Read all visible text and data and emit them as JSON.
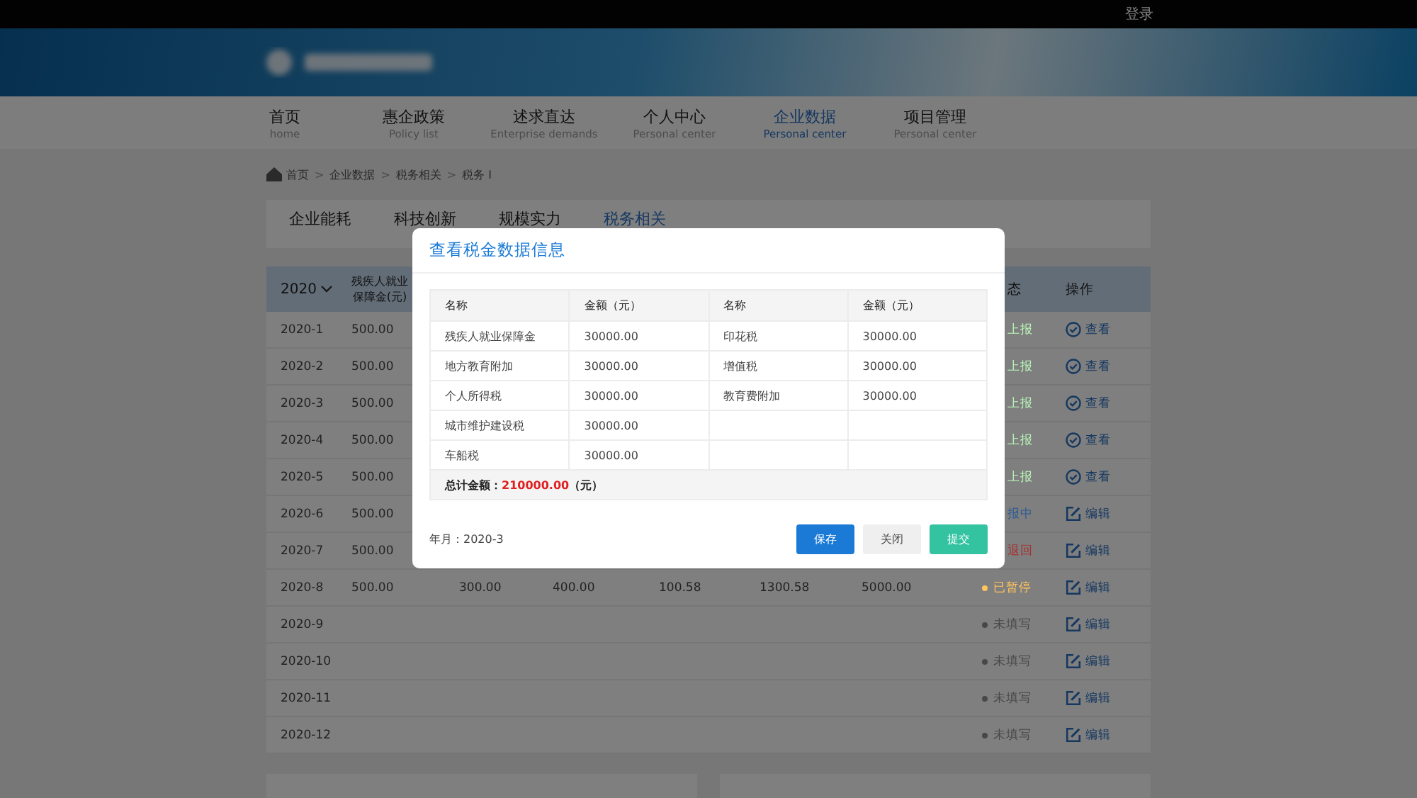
{
  "top_bar": {
    "login": "登录"
  },
  "nav": [
    {
      "label": "首页",
      "sub": "home",
      "selected": false
    },
    {
      "label": "惠企政策",
      "sub": "Policy list",
      "selected": false
    },
    {
      "label": "述求直达",
      "sub": "Enterprise demands",
      "selected": false
    },
    {
      "label": "个人中心",
      "sub": "Personal center",
      "selected": false
    },
    {
      "label": "企业数据",
      "sub": "Personal center",
      "selected": true
    },
    {
      "label": "项目管理",
      "sub": "Personal center",
      "selected": false
    }
  ],
  "breadcrumb": [
    {
      "kind": "link",
      "text": "首页"
    },
    {
      "kind": "separator",
      "text": ">"
    },
    {
      "kind": "link",
      "text": "企业数据"
    },
    {
      "kind": "separator",
      "text": ">"
    },
    {
      "kind": "link",
      "text": "税务相关"
    },
    {
      "kind": "separator",
      "text": ">"
    },
    {
      "kind": "link",
      "text": "税务 I"
    }
  ],
  "tabs": [
    {
      "label": "企业能耗",
      "selected": false
    },
    {
      "label": "科技创新",
      "selected": false
    },
    {
      "label": "规模实力",
      "selected": false
    },
    {
      "label": "税务相关",
      "selected": true
    }
  ],
  "table": {
    "year": "2020",
    "columns": [
      "残疾人就业保障金(元)"
    ],
    "status_header": "态",
    "action_header": "操作",
    "rows": [
      {
        "month": "2020-1",
        "cells": [
          "500.00"
        ],
        "status": {
          "text": "上报",
          "color": "#b8f5b8",
          "dot": false
        },
        "action": {
          "kind": "view",
          "label": "查看"
        }
      },
      {
        "month": "2020-2",
        "cells": [
          "500.00"
        ],
        "status": {
          "text": "上报",
          "color": "#b8f5b8",
          "dot": false
        },
        "action": {
          "kind": "view",
          "label": "查看"
        }
      },
      {
        "month": "2020-3",
        "cells": [
          "500.00"
        ],
        "status": {
          "text": "上报",
          "color": "#b8f5b8",
          "dot": false
        },
        "action": {
          "kind": "view",
          "label": "查看"
        }
      },
      {
        "month": "2020-4",
        "cells": [
          "500.00"
        ],
        "status": {
          "text": "上报",
          "color": "#b8f5b8",
          "dot": false
        },
        "action": {
          "kind": "view",
          "label": "查看"
        }
      },
      {
        "month": "2020-5",
        "cells": [
          "500.00"
        ],
        "status": {
          "text": "上报",
          "color": "#b8f5b8",
          "dot": false
        },
        "action": {
          "kind": "view",
          "label": "查看"
        }
      },
      {
        "month": "2020-6",
        "cells": [
          "500.00"
        ],
        "status": {
          "text": "报中",
          "color": "#2a5a95",
          "dot": false
        },
        "action": {
          "kind": "edit",
          "label": "编辑"
        }
      },
      {
        "month": "2020-7",
        "cells": [
          "500.00"
        ],
        "status": {
          "text": "退回",
          "color": "#a83030",
          "dot": false
        },
        "action": {
          "kind": "edit",
          "label": "编辑"
        }
      },
      {
        "month": "2020-8",
        "cells": [
          "500.00",
          "300.00",
          "400.00",
          "100.58",
          "1300.58",
          "5000.00"
        ],
        "status": {
          "text": "已暂停",
          "color": "#ffc45e",
          "dot": true
        },
        "action": {
          "kind": "edit",
          "label": "编辑"
        }
      },
      {
        "month": "2020-9",
        "cells": [],
        "status": {
          "text": "未填写",
          "color": "#484848",
          "dot": true
        },
        "action": {
          "kind": "edit",
          "label": "编辑"
        }
      },
      {
        "month": "2020-10",
        "cells": [],
        "status": {
          "text": "未填写",
          "color": "#484848",
          "dot": true
        },
        "action": {
          "kind": "edit",
          "label": "编辑"
        }
      },
      {
        "month": "2020-11",
        "cells": [],
        "status": {
          "text": "未填写",
          "color": "#484848",
          "dot": true
        },
        "action": {
          "kind": "edit",
          "label": "编辑"
        }
      },
      {
        "month": "2020-12",
        "cells": [],
        "status": {
          "text": "未填写",
          "color": "#484848",
          "dot": true
        },
        "action": {
          "kind": "edit",
          "label": "编辑"
        }
      }
    ]
  },
  "dialog": {
    "title": "查看税金数据信息",
    "columns": [
      "名称",
      "金额（元）",
      "名称",
      "金额（元）"
    ],
    "rows": [
      [
        "残疾人就业保障金",
        "30000.00",
        "印花税",
        "30000.00"
      ],
      [
        "地方教育附加",
        "30000.00",
        "增值税",
        "30000.00"
      ],
      [
        "个人所得税",
        "30000.00",
        "教育费附加",
        "30000.00"
      ],
      [
        "城市维护建设税",
        "30000.00"
      ],
      [
        "车船税",
        "30000.00"
      ]
    ],
    "total": {
      "label": "总计金额：",
      "amount": "210000.00",
      "unit": "（元）"
    },
    "period": "年月：2020-3",
    "buttons": [
      {
        "label": "保存",
        "kind": "primary"
      },
      {
        "label": "关闭",
        "kind": "default"
      },
      {
        "label": "提交",
        "kind": "success"
      }
    ]
  }
}
